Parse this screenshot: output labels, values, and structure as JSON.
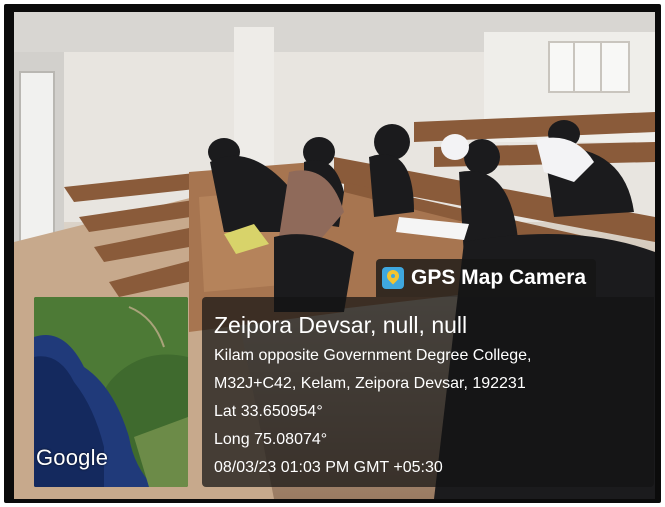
{
  "overlay": {
    "app_name": "GPS Map Camera",
    "icon": "gps-map-camera-icon",
    "location_title": "Zeipora Devsar, null, null",
    "address_line1": "Kilam opposite Government Degree College,",
    "address_line2": "M32J+C42, Kelam, Zeipora Devsar, 192231",
    "latitude": "Lat 33.650954°",
    "longitude": "Long 75.08074°",
    "datetime": "08/03/23 01:03 PM GMT +05:30"
  },
  "map": {
    "provider_label": "Google"
  },
  "colors": {
    "panel_bg": "#141414",
    "icon_blue": "#3fa7de",
    "icon_yellow": "#f3c431"
  }
}
